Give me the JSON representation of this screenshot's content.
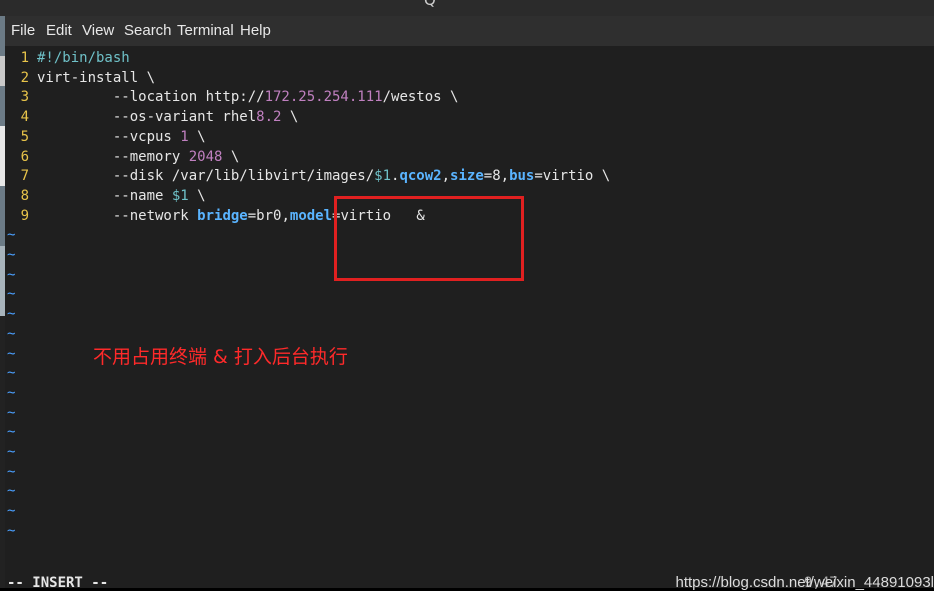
{
  "menu": [
    "File",
    "Edit",
    "View",
    "Search",
    "Terminal",
    "Help"
  ],
  "title_fragment": "Q",
  "code": {
    "lines": [
      {
        "n": "1",
        "parts": [
          {
            "t": "#!/bin/bash",
            "c": "teal"
          }
        ]
      },
      {
        "n": "2",
        "parts": [
          {
            "t": "virt-install \\",
            "c": "white"
          }
        ]
      },
      {
        "n": "3",
        "parts": [
          {
            "t": "         --location http://",
            "c": "white"
          },
          {
            "t": "172.25.254.111",
            "c": "purple"
          },
          {
            "t": "/westos \\",
            "c": "white"
          }
        ]
      },
      {
        "n": "4",
        "parts": [
          {
            "t": "         --os-variant rhel",
            "c": "white"
          },
          {
            "t": "8.2",
            "c": "purple"
          },
          {
            "t": " \\",
            "c": "white"
          }
        ]
      },
      {
        "n": "5",
        "parts": [
          {
            "t": "         --vcpus ",
            "c": "white"
          },
          {
            "t": "1",
            "c": "purple"
          },
          {
            "t": " \\",
            "c": "white"
          }
        ]
      },
      {
        "n": "6",
        "parts": [
          {
            "t": "         --memory ",
            "c": "white"
          },
          {
            "t": "2048",
            "c": "purple"
          },
          {
            "t": " \\",
            "c": "white"
          }
        ]
      },
      {
        "n": "7",
        "parts": [
          {
            "t": "         --disk /var/lib/libvirt/images/",
            "c": "white"
          },
          {
            "t": "$1",
            "c": "teal"
          },
          {
            "t": ".",
            "c": "white"
          },
          {
            "t": "qcow2",
            "c": "blue"
          },
          {
            "t": ",",
            "c": "white"
          },
          {
            "t": "size",
            "c": "blue"
          },
          {
            "t": "=8,",
            "c": "white"
          },
          {
            "t": "bus",
            "c": "blue"
          },
          {
            "t": "=virtio \\",
            "c": "white"
          }
        ]
      },
      {
        "n": "8",
        "parts": [
          {
            "t": "         --name ",
            "c": "white"
          },
          {
            "t": "$1",
            "c": "teal"
          },
          {
            "t": " \\",
            "c": "white"
          }
        ]
      },
      {
        "n": "9",
        "parts": [
          {
            "t": "         --network ",
            "c": "white"
          },
          {
            "t": "bridge",
            "c": "blue"
          },
          {
            "t": "=br0,",
            "c": "white"
          },
          {
            "t": "model",
            "c": "blue"
          },
          {
            "t": "=virtio   &",
            "c": "white"
          }
        ]
      }
    ],
    "tilde": "~"
  },
  "annotation": "不用占用终端 & 打入后台执行",
  "status": {
    "mode": "-- INSERT --",
    "cursor": "9,47",
    "watermark": "https://blog.csdn.net/weixin_44891093l"
  }
}
